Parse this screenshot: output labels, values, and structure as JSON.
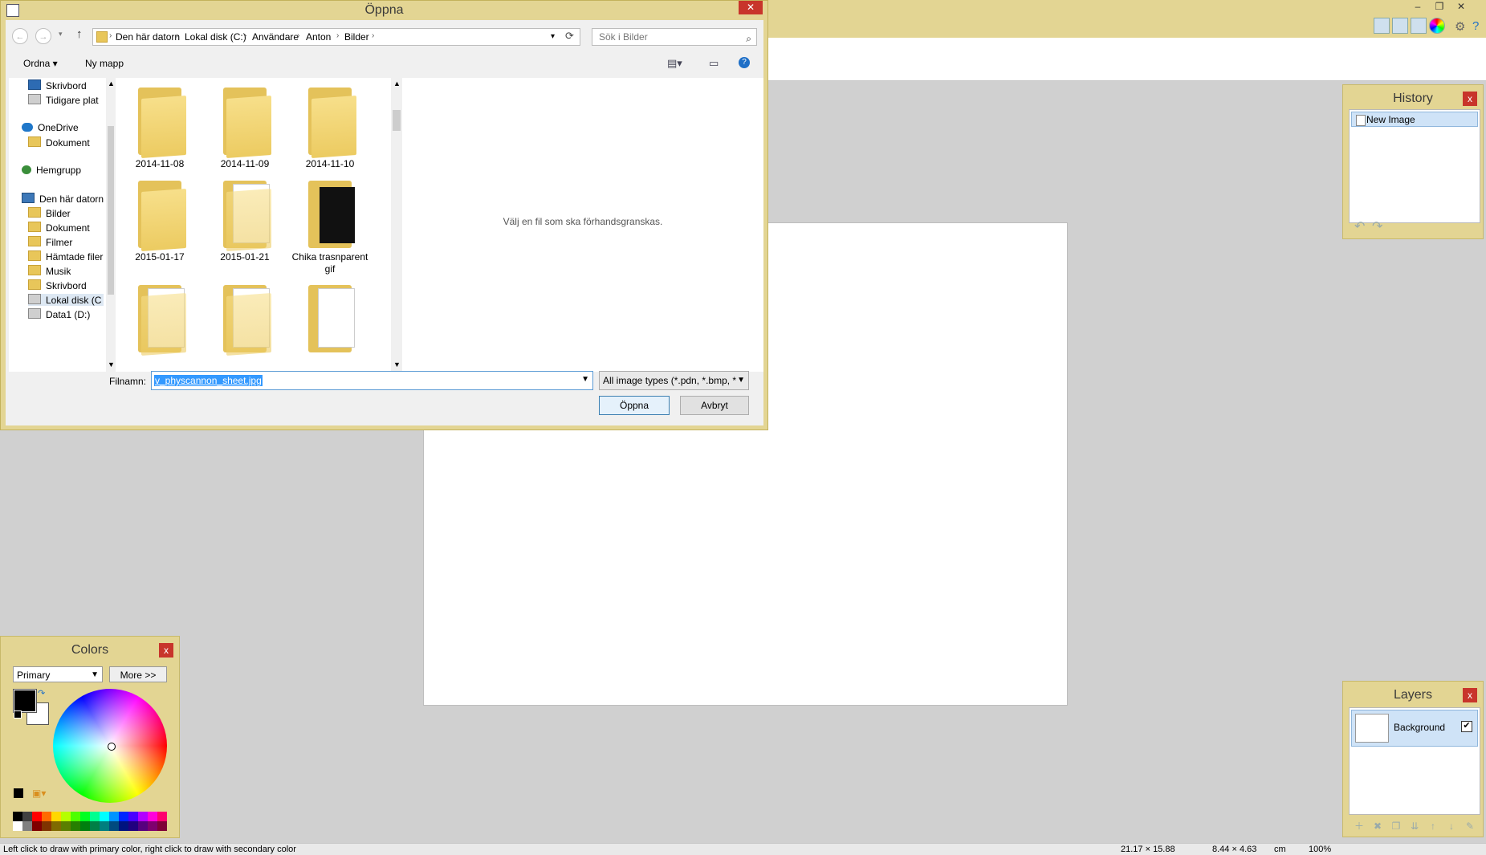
{
  "app": {
    "window_controls": {
      "minimize": "–",
      "restore": "❐",
      "close": "✕"
    }
  },
  "dialog": {
    "title": "Öppna",
    "close_glyph": "✕",
    "breadcrumbs": [
      "Den här datorn",
      "Lokal disk (C:)",
      "Användare",
      "Anton",
      "Bilder"
    ],
    "search_placeholder": "Sök i Bilder",
    "commands": {
      "organize": "Ordna ▾",
      "new_folder": "Ny mapp"
    },
    "nav_items": [
      {
        "label": "Skrivbord",
        "icon": "desktop-icon"
      },
      {
        "label": "Tidigare plat",
        "icon": "recent-icon"
      },
      {
        "label": "OneDrive",
        "icon": "cloud-icon"
      },
      {
        "label": "Dokument",
        "icon": "folder-icon"
      },
      {
        "label": "Hemgrupp",
        "icon": "homegroup-icon"
      },
      {
        "label": "Den här datorn",
        "icon": "computer-icon"
      },
      {
        "label": "Bilder",
        "icon": "folder-icon"
      },
      {
        "label": "Dokument",
        "icon": "folder-icon"
      },
      {
        "label": "Filmer",
        "icon": "folder-icon"
      },
      {
        "label": "Hämtade filer",
        "icon": "folder-icon"
      },
      {
        "label": "Musik",
        "icon": "folder-icon"
      },
      {
        "label": "Skrivbord",
        "icon": "folder-icon"
      },
      {
        "label": "Lokal disk (C",
        "icon": "drive-icon"
      },
      {
        "label": "Data1 (D:)",
        "icon": "drive-icon"
      }
    ],
    "files": [
      {
        "label": "2014-11-08"
      },
      {
        "label": "2014-11-09"
      },
      {
        "label": "2014-11-10"
      },
      {
        "label": "2015-01-17"
      },
      {
        "label": "2015-01-21"
      },
      {
        "label": "Chika trasnparent gif"
      },
      {
        "label": ""
      },
      {
        "label": ""
      },
      {
        "label": ""
      }
    ],
    "preview_text": "Välj en fil som ska förhandsgranskas.",
    "filename_label": "Filnamn:",
    "filename_value": "v_physcannon_sheet.jpg",
    "filter_value": "All image types (*.pdn, *.bmp, *",
    "open_button": "Öppna",
    "cancel_button": "Avbryt"
  },
  "history": {
    "title": "History",
    "close_glyph": "x",
    "items": [
      "New Image"
    ]
  },
  "colors": {
    "title": "Colors",
    "close_glyph": "x",
    "mode_select": "Primary",
    "more_button": "More >>",
    "primary_color": "#000000",
    "secondary_color": "#ffffff",
    "palette": [
      "#000000",
      "#404040",
      "#ff0000",
      "#ff6a00",
      "#ffd800",
      "#b6ff00",
      "#4cff00",
      "#00ff21",
      "#00ff90",
      "#00ffff",
      "#0094ff",
      "#0026ff",
      "#4800ff",
      "#b200ff",
      "#ff00dc",
      "#ff006e",
      "#ffffff",
      "#808080",
      "#7f0000",
      "#7f3300",
      "#7f6a00",
      "#5b7f00",
      "#267f00",
      "#007f0e",
      "#007f46",
      "#007f7f",
      "#004a7f",
      "#00137f",
      "#21007f",
      "#57007f",
      "#7f006e",
      "#7f0037"
    ]
  },
  "layers": {
    "title": "Layers",
    "close_glyph": "x",
    "items": [
      {
        "name": "Background",
        "visible": true
      }
    ]
  },
  "status": {
    "hint": "Left click to draw with primary color, right click to draw with secondary color",
    "cursor": "21.17 × 15.88",
    "selection": "8.44 × 4.63",
    "units": "cm",
    "zoom": "100%"
  },
  "colors_theme": {
    "chrome": "#e3d593",
    "close": "#c8352b",
    "selection": "#cfe3f7"
  }
}
